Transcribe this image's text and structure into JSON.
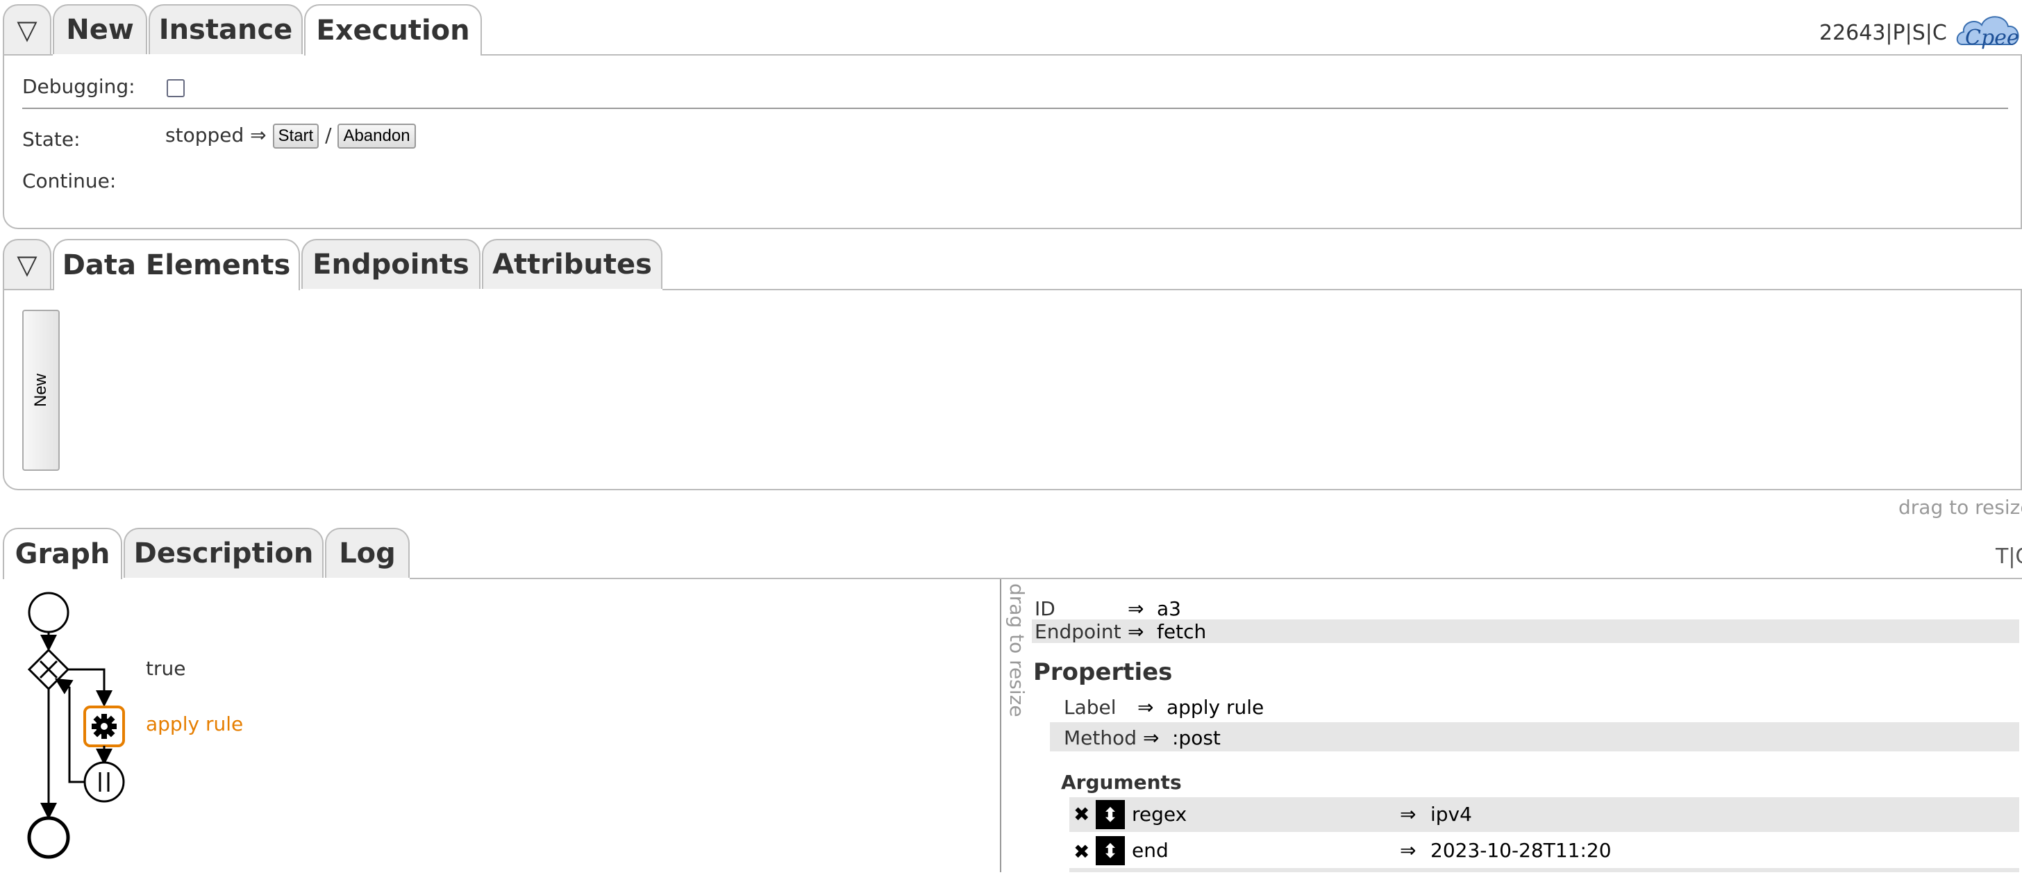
{
  "colors": {
    "accent_orange": "#e67e00",
    "border": "#bbbbbb",
    "row_grey": "#e6e6e6"
  },
  "top_tabs": {
    "toggle": "▽",
    "tabs": [
      "New",
      "Instance",
      "Execution"
    ],
    "active": "Execution",
    "instance_info": "22643|P|S|C",
    "logo_text": "Cpee"
  },
  "execution": {
    "debugging_label": "Debugging:",
    "state_label": "State:",
    "state_value": "stopped ⇒",
    "start_button": "Start",
    "separator": "/",
    "abandon_button": "Abandon",
    "continue_label": "Continue:"
  },
  "mid_tabs": {
    "toggle": "▽",
    "tabs": [
      "Data Elements",
      "Endpoints",
      "Attributes"
    ],
    "active": "Data Elements",
    "new_button": "New",
    "resize_hint": "drag to resize"
  },
  "bottom_tabs": {
    "tabs": [
      "Graph",
      "Description",
      "Log"
    ],
    "active": "Graph",
    "right_label": "T|C"
  },
  "graph": {
    "branch_label": "true",
    "task_label": "apply rule",
    "task_icon": "gear-icon"
  },
  "details": {
    "resize_hint": "drag to resize",
    "id_key": "ID",
    "id_value": "a3",
    "endpoint_key": "Endpoint",
    "endpoint_value": "fetch",
    "arrow": "⇒",
    "properties_heading": "Properties",
    "label_key": "Label",
    "label_value": "apply rule",
    "method_key": "Method",
    "method_value": ":post",
    "arguments_heading": "Arguments",
    "arguments": [
      {
        "name": "regex",
        "value": "ipv4"
      },
      {
        "name": "end",
        "value": "2023-10-28T11:20"
      }
    ]
  }
}
